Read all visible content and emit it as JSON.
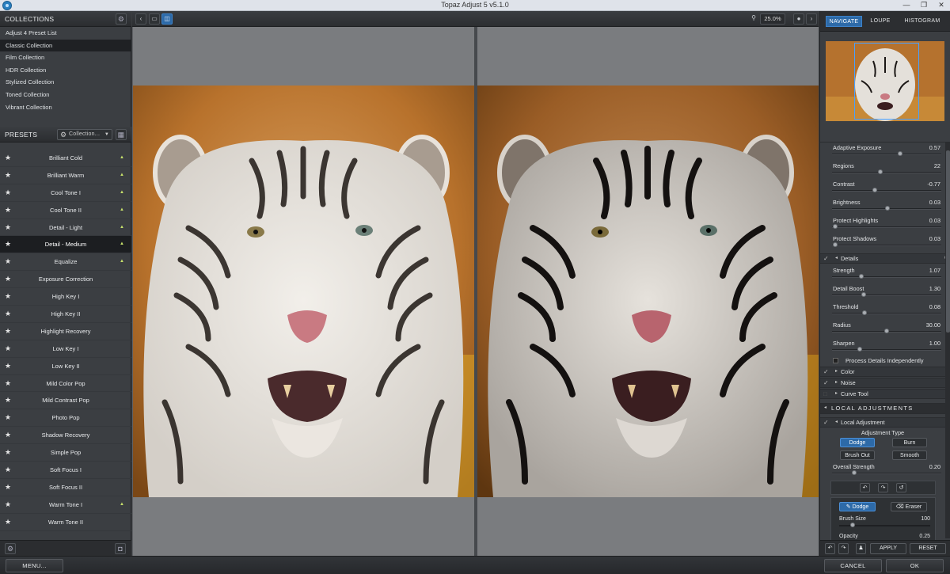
{
  "window": {
    "title": "Topaz Adjust 5 v5.1.0",
    "minimize": "—",
    "restore": "❐",
    "close": "✕"
  },
  "collections": {
    "header": "COLLECTIONS",
    "items": [
      "Adjust 4 Preset List",
      "Classic Collection",
      "Film Collection",
      "HDR Collection",
      "Stylized Collection",
      "Toned Collection",
      "Vibrant Collection"
    ],
    "selected_index": 1
  },
  "presets": {
    "header": "PRESETS",
    "dropdown_label": "Collection...",
    "items": [
      "Brilliant Cold",
      "Brilliant Warm",
      "Cool Tone I",
      "Cool Tone II",
      "Detail - Light",
      "Detail - Medium",
      "Equalize",
      "Exposure Correction",
      "High Key I",
      "High Key II",
      "Highlight Recovery",
      "Low Key I",
      "Low Key II",
      "Mild Color Pop",
      "Mild Contrast Pop",
      "Photo Pop",
      "Shadow Recovery",
      "Simple Pop",
      "Soft Focus I",
      "Soft Focus II",
      "Warm Tone I",
      "Warm Tone II"
    ],
    "flagged": [
      true,
      true,
      true,
      true,
      true,
      true,
      true,
      false,
      false,
      false,
      false,
      false,
      false,
      false,
      false,
      false,
      false,
      false,
      false,
      false,
      true,
      false
    ],
    "selected_index": 5
  },
  "toolbar": {
    "zoom": "25.0%"
  },
  "navigator": {
    "tabs": [
      "NAVIGATE",
      "LOUPE",
      "HISTOGRAM"
    ],
    "active_tab": 0
  },
  "adjustments": {
    "top_sliders": [
      {
        "label": "Adaptive Exposure",
        "value": "0.57",
        "pos": 0.62
      },
      {
        "label": "Regions",
        "value": "22",
        "pos": 0.44
      },
      {
        "label": "Contrast",
        "value": "-0.77",
        "pos": 0.39
      },
      {
        "label": "Brightness",
        "value": "0.03",
        "pos": 0.51
      },
      {
        "label": "Protect Highlights",
        "value": "0.03",
        "pos": 0.03
      },
      {
        "label": "Protect Shadows",
        "value": "0.03",
        "pos": 0.03
      }
    ],
    "details_label": "Details",
    "detail_sliders": [
      {
        "label": "Strength",
        "value": "1.07",
        "pos": 0.27
      },
      {
        "label": "Detail Boost",
        "value": "1.30",
        "pos": 0.29
      },
      {
        "label": "Threshold",
        "value": "0.08",
        "pos": 0.3
      },
      {
        "label": "Radius",
        "value": "30.00",
        "pos": 0.5
      },
      {
        "label": "Sharpen",
        "value": "1.00",
        "pos": 0.25
      }
    ],
    "process_independently": "Process Details Independently",
    "color_label": "Color",
    "noise_label": "Noise",
    "curve_label": "Curve Tool"
  },
  "local": {
    "header": "LOCAL ADJUSTMENTS",
    "sub_label": "Local Adjustment",
    "type_label": "Adjustment Type",
    "buttons": [
      "Dodge",
      "Burn",
      "Brush Out",
      "Smooth"
    ],
    "overall_label": "Overall Strength",
    "overall_value": "0.20",
    "overall_pos": 0.2,
    "brush": {
      "dodge": "Dodge",
      "eraser": "Eraser",
      "size_label": "Brush Size",
      "size_value": "100",
      "size_pos": 0.15,
      "opacity_label": "Opacity",
      "opacity_value": "0.25"
    }
  },
  "right_footer": {
    "apply": "APPLY",
    "reset": "RESET"
  },
  "footer": {
    "menu": "MENU...",
    "cancel": "CANCEL",
    "ok": "OK"
  }
}
